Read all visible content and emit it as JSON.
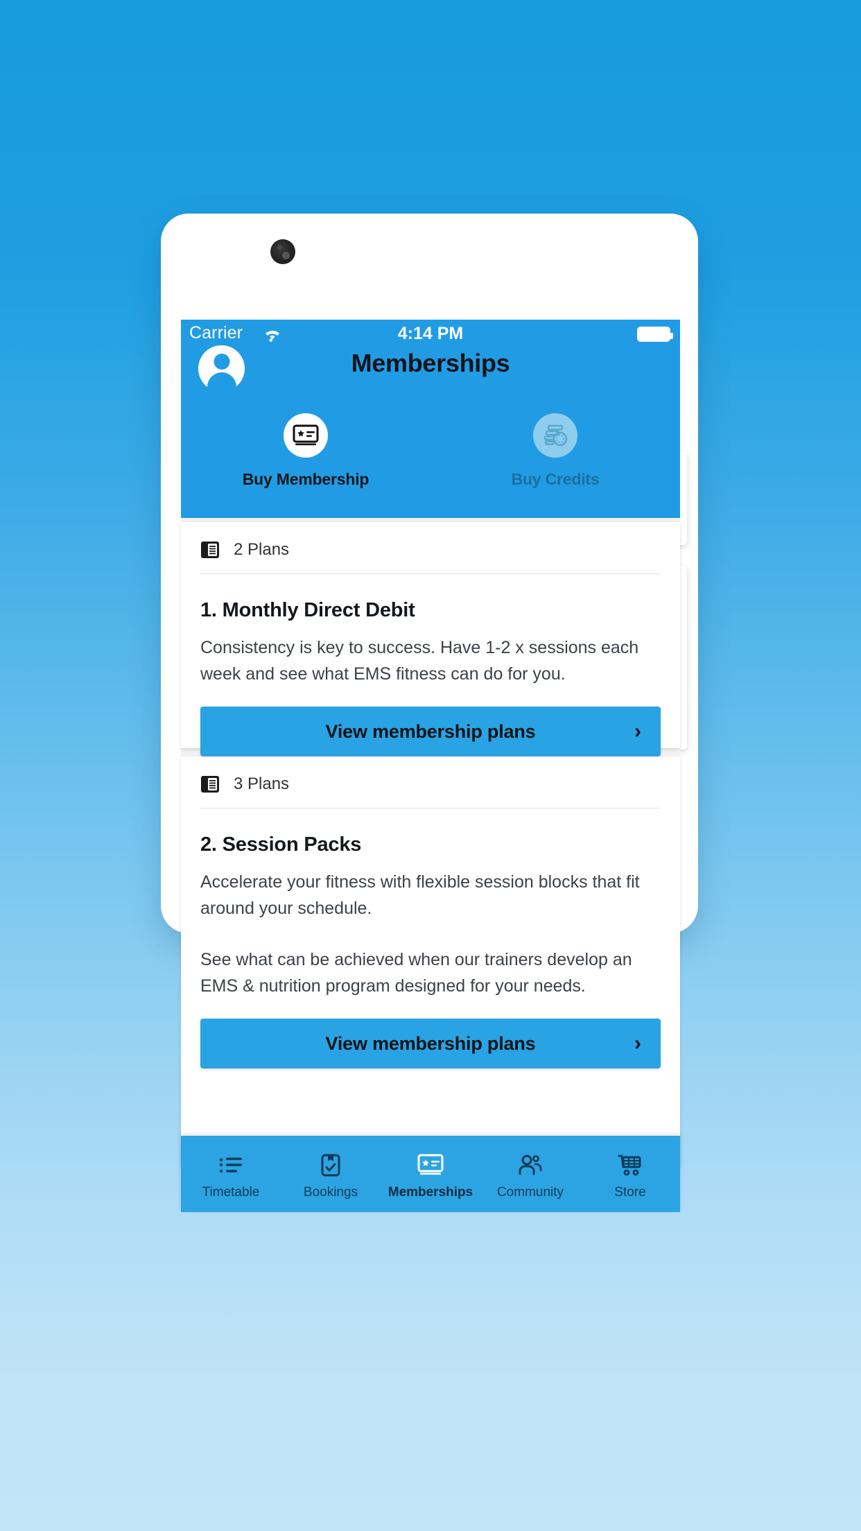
{
  "theme": {
    "bg_gradient_top": "#189ADF",
    "bg_gradient_bottom": "#C3E5F8",
    "brand_blue": "#219CE4",
    "cta_blue": "#29A3E3",
    "tabbar_blue": "#2CA4E3",
    "content_bg": "#F2F2F2"
  },
  "status_bar": {
    "carrier": "Carrier",
    "wifi_icon": "wifi-icon",
    "time": "4:14 PM",
    "battery_icon": "battery-full-icon"
  },
  "header": {
    "avatar_icon": "user-avatar-icon",
    "title": "Memberships",
    "actions": [
      {
        "label": "Buy Membership",
        "icon": "membership-card-icon",
        "state": "enabled"
      },
      {
        "label": "Buy Credits",
        "icon": "credits-money-icon",
        "state": "disabled"
      }
    ]
  },
  "content": {
    "cards": [
      {
        "plans_icon": "plans-list-icon",
        "plans_count": "2 Plans",
        "title": "1. Monthly Direct Debit",
        "paragraphs": [
          "Consistency is key to success. Have 1-2 x sessions each week and see what EMS fitness can do for you."
        ],
        "cta_label": "View membership plans",
        "cta_chevron": "chevron-right-icon"
      },
      {
        "plans_icon": "plans-list-icon",
        "plans_count": "3 Plans",
        "title": "2. Session Packs",
        "paragraphs": [
          "Accelerate your fitness with flexible session blocks that fit around your schedule.",
          "See what can be achieved when our trainers develop an EMS & nutrition program designed for your needs."
        ],
        "cta_label": "View membership plans",
        "cta_chevron": "chevron-right-icon"
      }
    ]
  },
  "tabbar": {
    "items": [
      {
        "label": "Timetable",
        "icon": "timetable-list-icon",
        "active": false
      },
      {
        "label": "Bookings",
        "icon": "clipboard-check-icon",
        "active": false
      },
      {
        "label": "Memberships",
        "icon": "membership-card-icon",
        "active": true
      },
      {
        "label": "Community",
        "icon": "people-group-icon",
        "active": false
      },
      {
        "label": "Store",
        "icon": "shopping-cart-icon",
        "active": false
      }
    ]
  }
}
